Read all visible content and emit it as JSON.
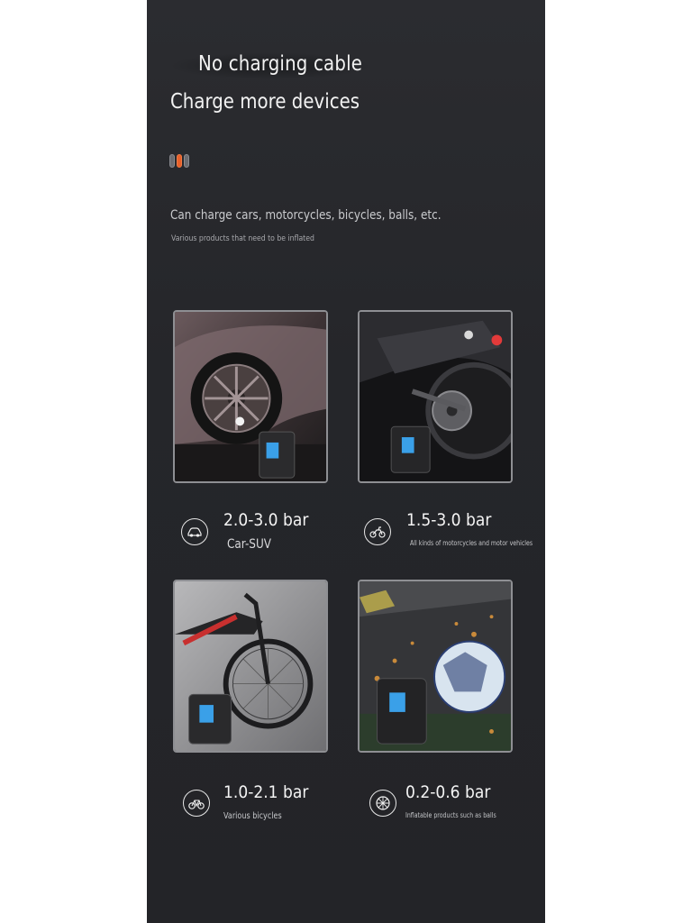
{
  "header": {
    "title_line1": "No charging cable",
    "title_line2": "Charge more devices",
    "subtitle": "Can charge cars, motorcycles, bicycles, balls, etc.",
    "caption": "Various products that need to be inflated"
  },
  "pager": {
    "count": 3,
    "active_index": 1,
    "accent": "#e8612b"
  },
  "items": [
    {
      "icon": "car-icon",
      "pressure": "2.0-3.0 bar",
      "description": "Car-SUV"
    },
    {
      "icon": "motorcycle-icon",
      "pressure": "1.5-3.0 bar",
      "description": "All kinds of motorcycles and motor vehicles"
    },
    {
      "icon": "bicycle-icon",
      "pressure": "1.0-2.1 bar",
      "description": "Various bicycles"
    },
    {
      "icon": "ball-icon",
      "pressure": "0.2-0.6 bar",
      "description": "Inflatable products such as balls"
    }
  ]
}
